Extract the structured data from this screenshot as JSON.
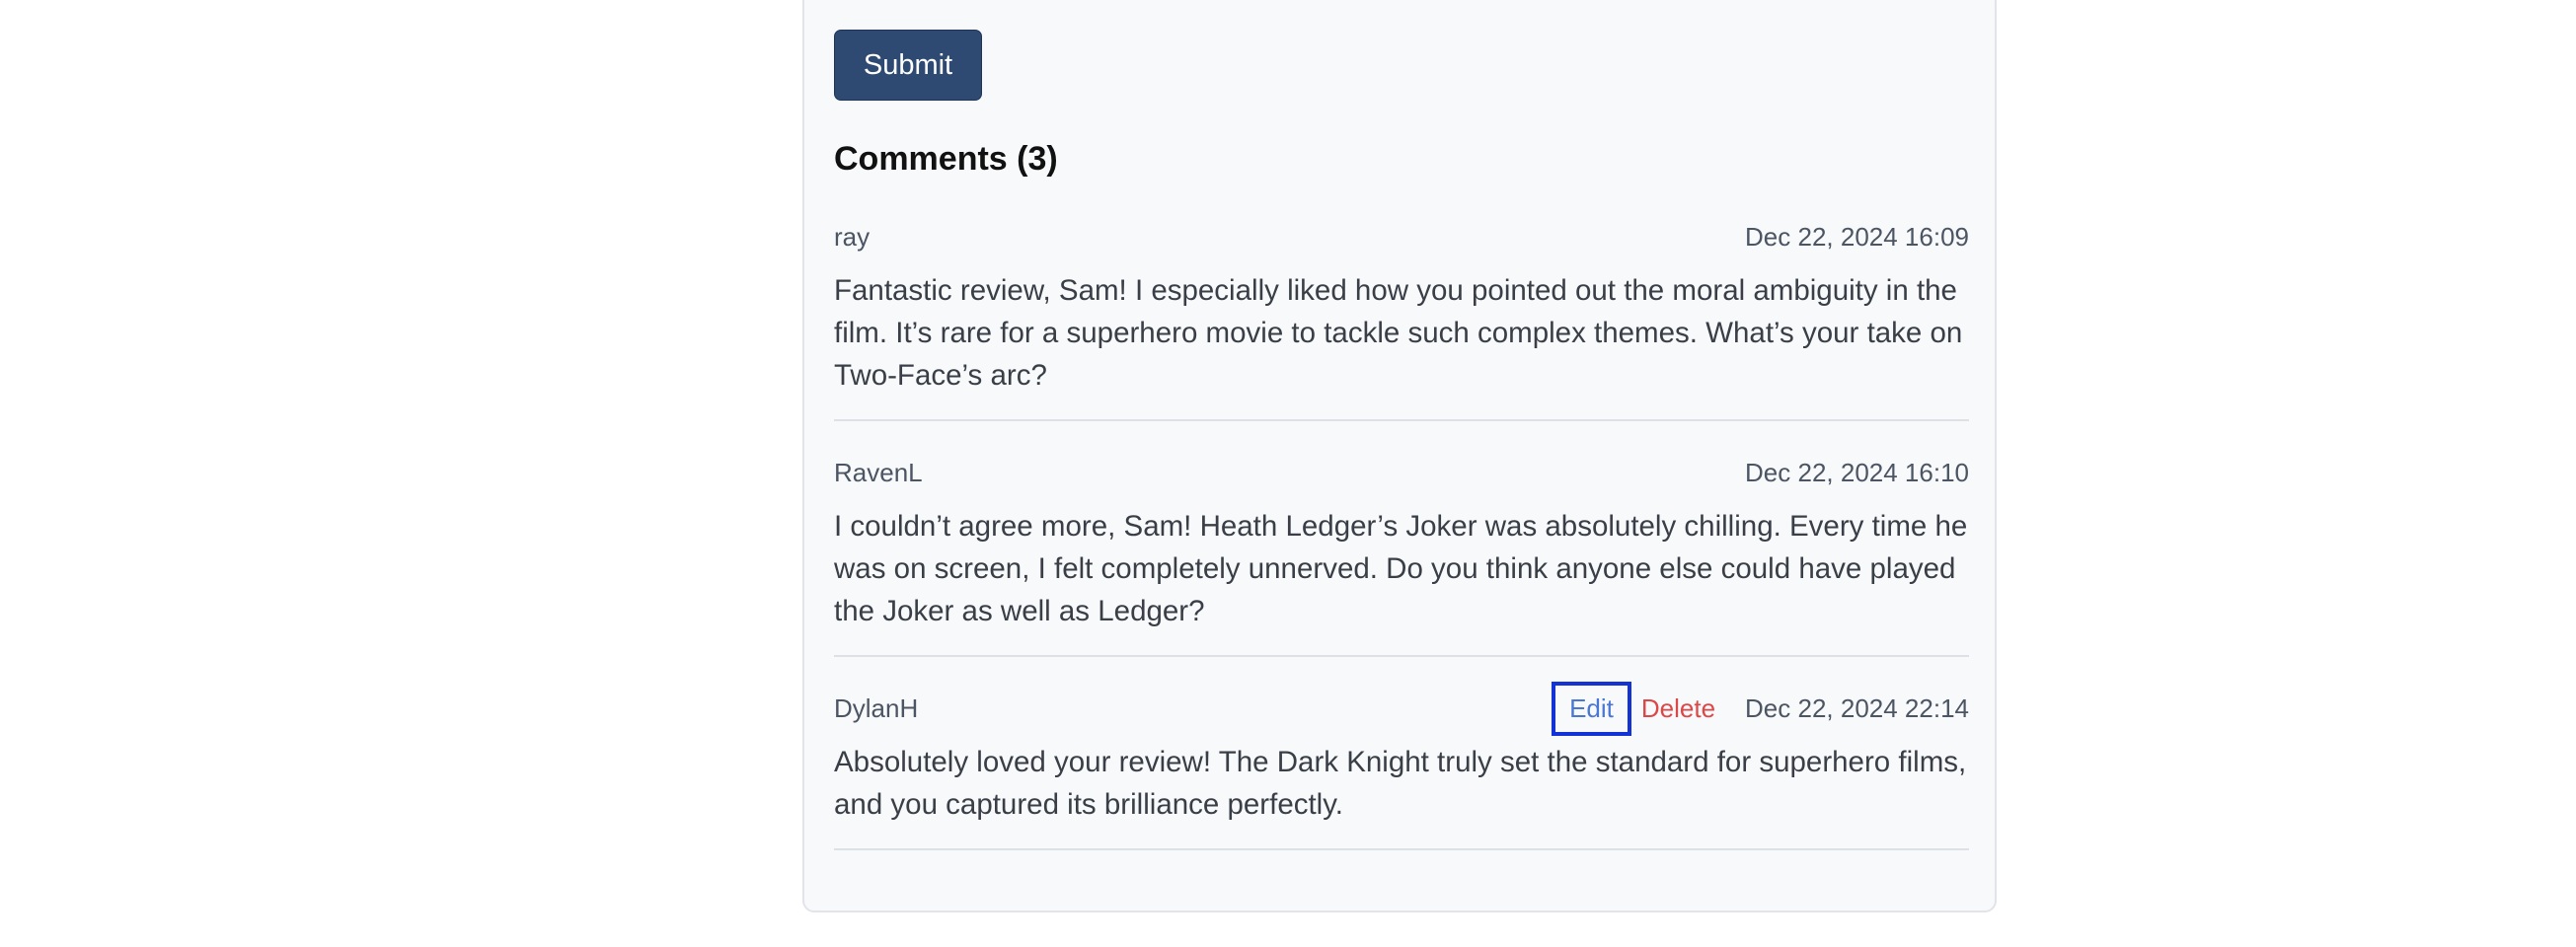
{
  "form": {
    "submit_label": "Submit"
  },
  "comments_heading": "Comments (3)",
  "comments": [
    {
      "author": "ray",
      "date": "Dec 22, 2024 16:09",
      "body": "Fantastic review, Sam! I especially liked how you pointed out the moral ambiguity in the film. It’s rare for a superhero movie to tackle such complex themes. What’s your take on Two-Face’s arc?"
    },
    {
      "author": "RavenL",
      "date": "Dec 22, 2024 16:10",
      "body": "I couldn’t agree more, Sam! Heath Ledger’s Joker was absolutely chilling. Every time he was on screen, I felt completely unnerved. Do you think anyone else could have played the Joker as well as Ledger?"
    },
    {
      "author": "DylanH",
      "date": "Dec 22, 2024 22:14",
      "edit_label": "Edit",
      "delete_label": "Delete",
      "body": "Absolutely loved your review! The Dark Knight truly set the standard for superhero films, and you captured its brilliance perfectly."
    }
  ],
  "colors": {
    "submit_bg": "#2f4a72",
    "edit_link": "#4a77d4",
    "delete_link": "#dc4848",
    "focus_outline": "#1433d6"
  }
}
